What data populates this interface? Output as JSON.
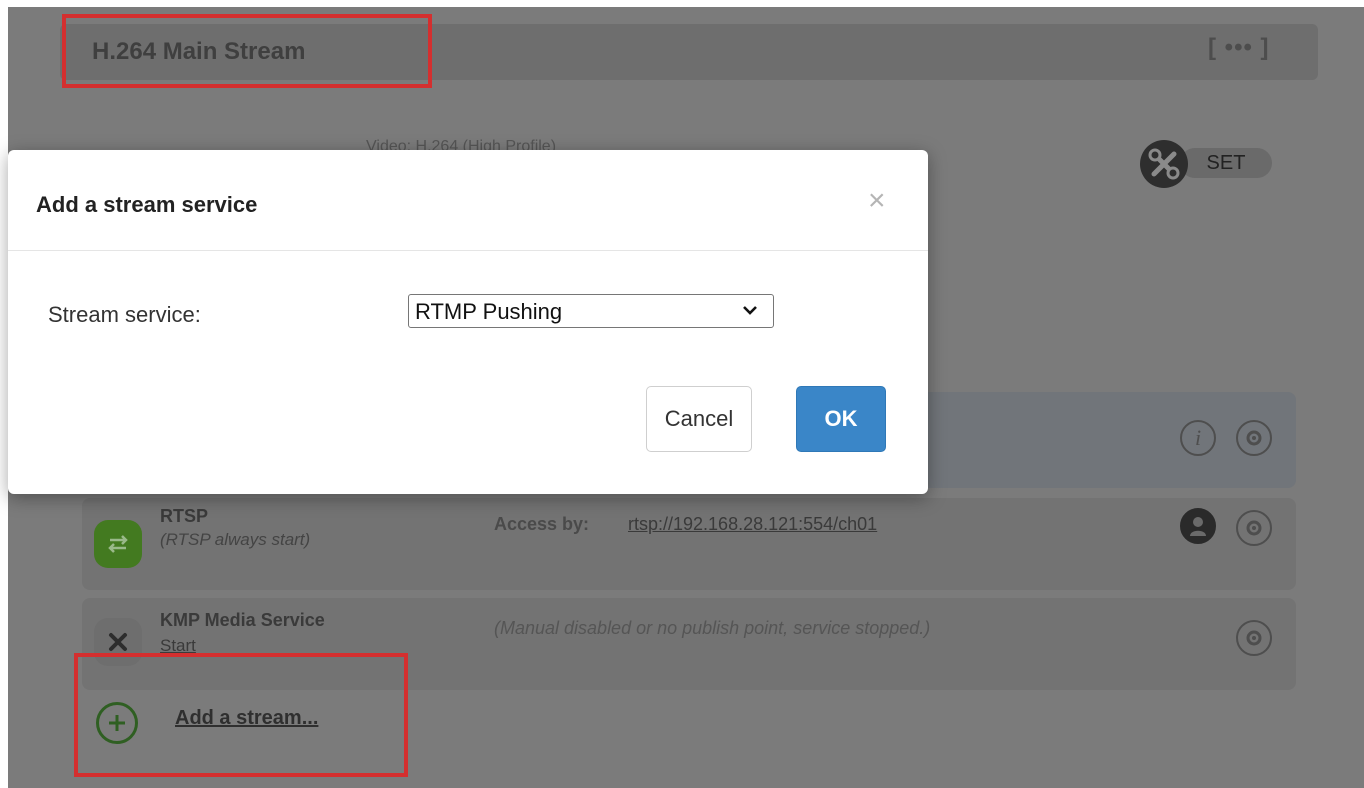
{
  "stream": {
    "title": "H.264 Main Stream",
    "more_label": "[ ••• ]",
    "video_info": "Video: H.264 (High Profile)",
    "set_label": "SET"
  },
  "services": [
    {
      "name": "RTSP",
      "subtitle": "(RTSP always start)",
      "access_label": "Access by:",
      "access_url": "rtsp://192.168.28.121:554/ch01"
    },
    {
      "name": "KMP Media Service",
      "link": "Start",
      "status": "(Manual disabled or no publish point, service stopped.)"
    }
  ],
  "add_stream_label": "Add a stream...",
  "modal": {
    "title": "Add a stream service",
    "close_symbol": "×",
    "field_label": "Stream service:",
    "selected_value": "RTMP Pushing",
    "cancel_label": "Cancel",
    "ok_label": "OK"
  },
  "colors": {
    "overlay": "#7b7b7b",
    "highlight": "#d42f2f",
    "ok_button": "#3a86c8",
    "rtsp_icon": "#437a20"
  },
  "icons": [
    "tools-icon",
    "info-icon",
    "gear-icon",
    "user-icon",
    "transfer-icon",
    "close-x-icon",
    "plus-circle-icon",
    "chevron-down-icon"
  ]
}
